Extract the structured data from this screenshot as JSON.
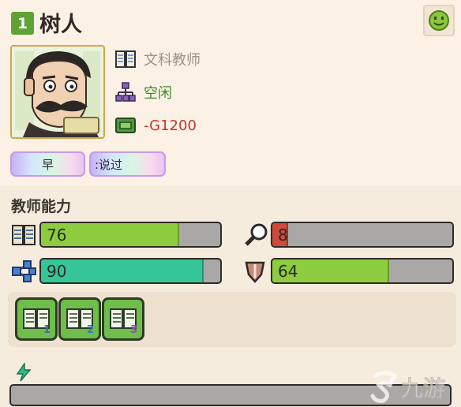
{
  "header": {
    "level": "1",
    "name": "树人",
    "mood_icon": "smiley-face-icon"
  },
  "teacher": {
    "subject": "文科教师",
    "status": "空闲",
    "salary": "-G1200"
  },
  "traits": [
    {
      "label": "早"
    },
    {
      "label": ":说过"
    }
  ],
  "abilities": {
    "title": "教师能力",
    "stats": [
      {
        "name": "teaching",
        "icon": "book-icon",
        "value": "76",
        "fraction": 0.76,
        "color": "#8ccc3e"
      },
      {
        "name": "research",
        "icon": "magnifier-icon",
        "value": "8",
        "fraction": 0.08,
        "color": "#cf4a3a"
      },
      {
        "name": "communication",
        "icon": "network-icon",
        "value": "90",
        "fraction": 0.9,
        "color": "#35c597"
      },
      {
        "name": "strength",
        "icon": "shield-icon",
        "value": "64",
        "fraction": 0.64,
        "color": "#8ccc3e"
      }
    ]
  },
  "book_slots": [
    {
      "label": "1",
      "icon": "open-book-icon"
    },
    {
      "label": "2",
      "icon": "open-book-icon"
    },
    {
      "label": "3",
      "icon": "open-book-icon"
    }
  ],
  "energy": {
    "icon": "lightning-icon",
    "fraction": 0.0
  },
  "watermark": {
    "text": "九游"
  }
}
